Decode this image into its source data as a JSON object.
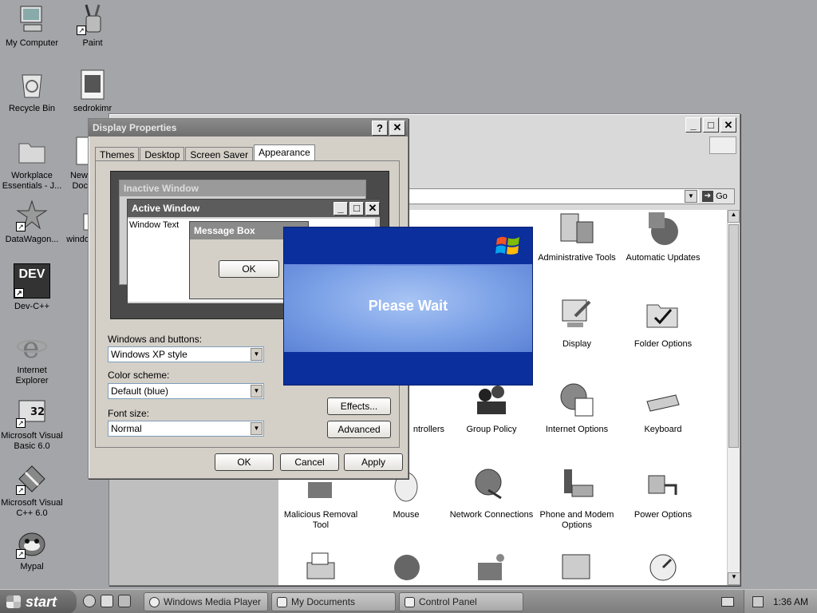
{
  "desktop": {
    "icons": [
      {
        "label": "My Computer",
        "icon": "computer-icon"
      },
      {
        "label": "Paint",
        "icon": "paint-icon"
      },
      {
        "label": "Recycle Bin",
        "icon": "recycle-bin-icon"
      },
      {
        "label": "sedrokimr",
        "icon": "image-file-icon"
      },
      {
        "label": "Workplace Essentials - J...",
        "icon": "folder-icon"
      },
      {
        "label": "New Doc",
        "icon": "document-icon"
      },
      {
        "label": "DataWagon...",
        "icon": "datawagon-icon"
      },
      {
        "label": "windo",
        "icon": "file-icon"
      },
      {
        "label": "Dev-C++",
        "icon": "devcpp-icon",
        "icon_text": "DEV"
      },
      {
        "label": "Internet Explorer",
        "icon": "ie-icon"
      },
      {
        "label": "Microsoft Visual Basic 6.0",
        "icon": "vb6-icon",
        "icon_text": "32"
      },
      {
        "label": "Microsoft Visual C++ 6.0",
        "icon": "vc6-icon"
      },
      {
        "label": "Mypal",
        "icon": "mypal-icon"
      }
    ]
  },
  "control_panel": {
    "go_label": "Go",
    "items": [
      {
        "label": "Administrative Tools",
        "icon": "admin-tools-icon"
      },
      {
        "label": "Automatic Updates",
        "icon": "automatic-updates-icon"
      },
      {
        "label": "Display",
        "icon": "display-icon"
      },
      {
        "label": "Folder Options",
        "icon": "folder-options-icon"
      },
      {
        "label": "ntrollers",
        "icon": "game-controllers-icon"
      },
      {
        "label": "Group Policy",
        "icon": "group-policy-icon"
      },
      {
        "label": "Internet Options",
        "icon": "internet-options-icon"
      },
      {
        "label": "Keyboard",
        "icon": "keyboard-icon"
      },
      {
        "label": "Malicious Removal Tool",
        "icon": "malicious-removal-icon"
      },
      {
        "label": "Mouse",
        "icon": "mouse-icon"
      },
      {
        "label": "Network Connections",
        "icon": "network-connections-icon"
      },
      {
        "label": "Phone and Modem Options",
        "icon": "phone-modem-icon"
      },
      {
        "label": "Power Options",
        "icon": "power-options-icon"
      }
    ]
  },
  "display_properties": {
    "title": "Display Properties",
    "tabs": [
      "Themes",
      "Desktop",
      "Screen Saver",
      "Appearance"
    ],
    "active_tab": "Appearance",
    "preview": {
      "inactive_title": "Inactive Window",
      "active_title": "Active Window",
      "window_text": "Window Text",
      "message_box_title": "Message Box",
      "ok_label": "OK"
    },
    "windows_buttons_label": "Windows and buttons:",
    "windows_buttons_value": "Windows XP style",
    "color_scheme_label": "Color scheme:",
    "color_scheme_value": "Default (blue)",
    "font_size_label": "Font size:",
    "font_size_value": "Normal",
    "effects_label": "Effects...",
    "advanced_label": "Advanced",
    "ok_label": "OK",
    "cancel_label": "Cancel",
    "apply_label": "Apply"
  },
  "please_wait": {
    "text": "Please Wait"
  },
  "taskbar": {
    "start_label": "start",
    "tasks": [
      "Windows Media Player",
      "My Documents",
      "Control Panel"
    ],
    "clock": "1:36 AM"
  }
}
